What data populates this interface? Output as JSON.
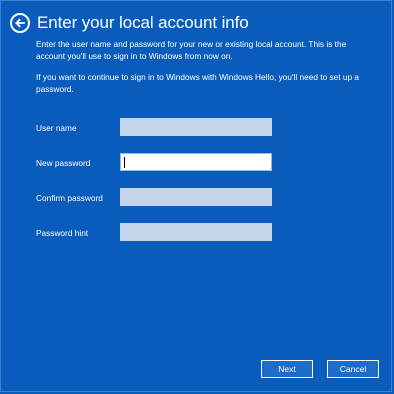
{
  "header": {
    "title": "Enter your local account info",
    "back_icon": "back-arrow-icon"
  },
  "description": {
    "paragraph1": "Enter the user name and password for your new or existing local account. This is the account you'll use to sign in to Windows from now on.",
    "paragraph2": "If you want to continue to sign in to Windows with Windows Hello, you'll need to set up a password."
  },
  "form": {
    "username": {
      "label": "User name",
      "value": ""
    },
    "new_password": {
      "label": "New password",
      "value": ""
    },
    "confirm_password": {
      "label": "Confirm password",
      "value": ""
    },
    "password_hint": {
      "label": "Password hint",
      "value": ""
    }
  },
  "buttons": {
    "next": "Next",
    "cancel": "Cancel"
  },
  "colors": {
    "background": "#0a5cbc",
    "input_muted": "#c3d5eb",
    "input_active": "#ffffff"
  }
}
